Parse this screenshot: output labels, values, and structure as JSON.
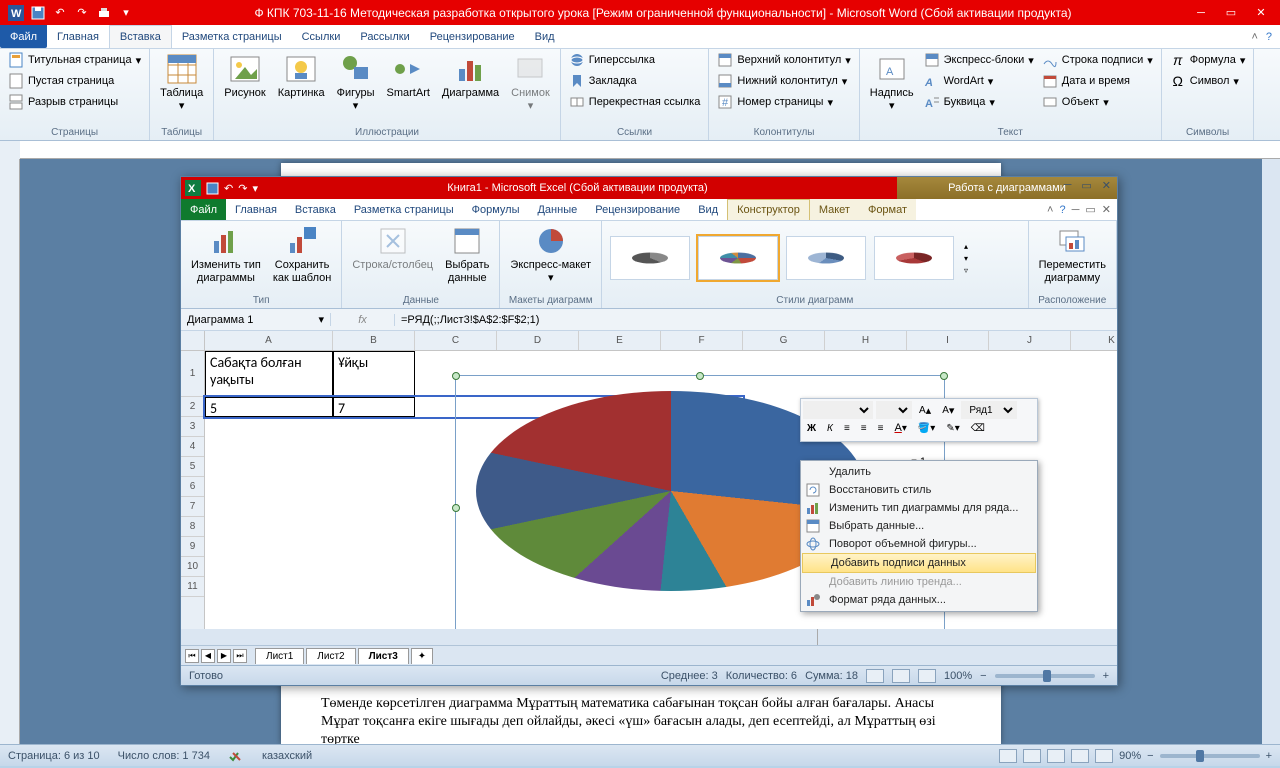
{
  "word": {
    "title": "Ф КПК 703-11-16  Методическая разработка открытого урока [Режим ограниченной функциональности]  -  Microsoft Word  (Сбой активации продукта)",
    "tabs": {
      "file": "Файл",
      "home": "Главная",
      "insert": "Вставка",
      "layout": "Разметка страницы",
      "refs": "Ссылки",
      "mail": "Рассылки",
      "review": "Рецензирование",
      "view": "Вид"
    },
    "ribbon": {
      "pages": {
        "title_page": "Титульная страница",
        "blank": "Пустая страница",
        "break": "Разрыв страницы",
        "caption": "Страницы"
      },
      "tables": {
        "btn": "Таблица",
        "caption": "Таблицы"
      },
      "illus": {
        "pic": "Рисунок",
        "clip": "Картинка",
        "shapes": "Фигуры",
        "smartart": "SmartArt",
        "chart": "Диаграмма",
        "screenshot": "Снимок",
        "caption": "Иллюстрации"
      },
      "links": {
        "hyper": "Гиперссылка",
        "bookmark": "Закладка",
        "crossref": "Перекрестная ссылка",
        "caption": "Ссылки"
      },
      "headfoot": {
        "head": "Верхний колонтитул",
        "foot": "Нижний колонтитул",
        "page": "Номер страницы",
        "caption": "Колонтитулы"
      },
      "text": {
        "textbox": "Надпись",
        "quickparts": "Экспресс-блоки",
        "wordart": "WordArt",
        "dropcap": "Буквица",
        "sigline": "Строка подписи",
        "datetime": "Дата и время",
        "object": "Объект",
        "caption": "Текст"
      },
      "symbols": {
        "formula": "Формула",
        "symbol": "Символ",
        "caption": "Символы"
      }
    },
    "body_para_bottom": "Төменде көрсетілген диаграмма Мұраттың математика сабағынан тоқсан бойы алған бағалары. Анасы Мұрат тоқсанға екіге шығады деп ойлайды, әкесі «үш» бағасын алады, деп есептейді, ал Мұраттың өзі төртке",
    "status": {
      "page": "Страница: 6 из 10",
      "words": "Число слов: 1 734",
      "lang": "казахский",
      "zoom": "90%"
    }
  },
  "excel": {
    "title": "Книга1  -  Microsoft Excel (Сбой активации продукта)",
    "chart_tools": "Работа с диаграммами",
    "tabs": {
      "file": "Файл",
      "home": "Главная",
      "insert": "Вставка",
      "layout": "Разметка страницы",
      "formulas": "Формулы",
      "data": "Данные",
      "review": "Рецензирование",
      "view": "Вид",
      "design": "Конструктор",
      "layout2": "Макет",
      "format": "Формат"
    },
    "ribbon": {
      "type": {
        "change": "Изменить тип\nдиаграммы",
        "save": "Сохранить\nкак шаблон",
        "caption": "Тип"
      },
      "data": {
        "switch": "Строка/столбец",
        "select": "Выбрать\nданные",
        "caption": "Данные"
      },
      "layout": {
        "quick": "Экспресс-макет",
        "caption": "Макеты диаграмм"
      },
      "styles": {
        "caption": "Стили диаграмм"
      },
      "location": {
        "move": "Переместить\nдиаграмму",
        "caption": "Расположение"
      }
    },
    "namebox": "Диаграмма 1",
    "formula": "=РЯД(;;Лист3!$A$2:$F$2;1)",
    "cols": [
      "A",
      "B",
      "C",
      "D",
      "E",
      "F",
      "G",
      "H",
      "I",
      "J",
      "K"
    ],
    "rows": [
      "1",
      "2",
      "3",
      "4",
      "5",
      "6",
      "7",
      "8",
      "9",
      "10",
      "11"
    ],
    "cells": {
      "A1": "Сабақта болған уақыты",
      "B1": "Ұйқы",
      "A2": "5",
      "B2": "7"
    },
    "legend": "1",
    "sheets": [
      "Лист1",
      "Лист2",
      "Лист3"
    ],
    "status": {
      "ready": "Готово",
      "avg": "Среднее: 3",
      "count": "Количество: 6",
      "sum": "Сумма: 18",
      "zoom": "100%"
    }
  },
  "mini": {
    "series": "Ряд1"
  },
  "context": {
    "delete": "Удалить",
    "restore": "Восстановить стиль",
    "changeType": "Изменить тип диаграммы для ряда...",
    "selectData": "Выбрать данные...",
    "rotate3d": "Поворот объемной фигуры...",
    "addLabels": "Добавить подписи данных",
    "addTrend": "Добавить линию тренда...",
    "formatSeries": "Формат ряда данных..."
  },
  "chart_data": {
    "type": "pie",
    "title": "",
    "series": [
      {
        "name": "1",
        "values": [
          5,
          7,
          null,
          null,
          null,
          null
        ]
      }
    ],
    "categories": [
      "Сабақта болған уақыты",
      "Ұйқы",
      "",
      "",
      "",
      ""
    ],
    "notes": "3-D объёмная круговая диаграмма; разложение по 6 секторам на основе диапазона A2:F2"
  }
}
